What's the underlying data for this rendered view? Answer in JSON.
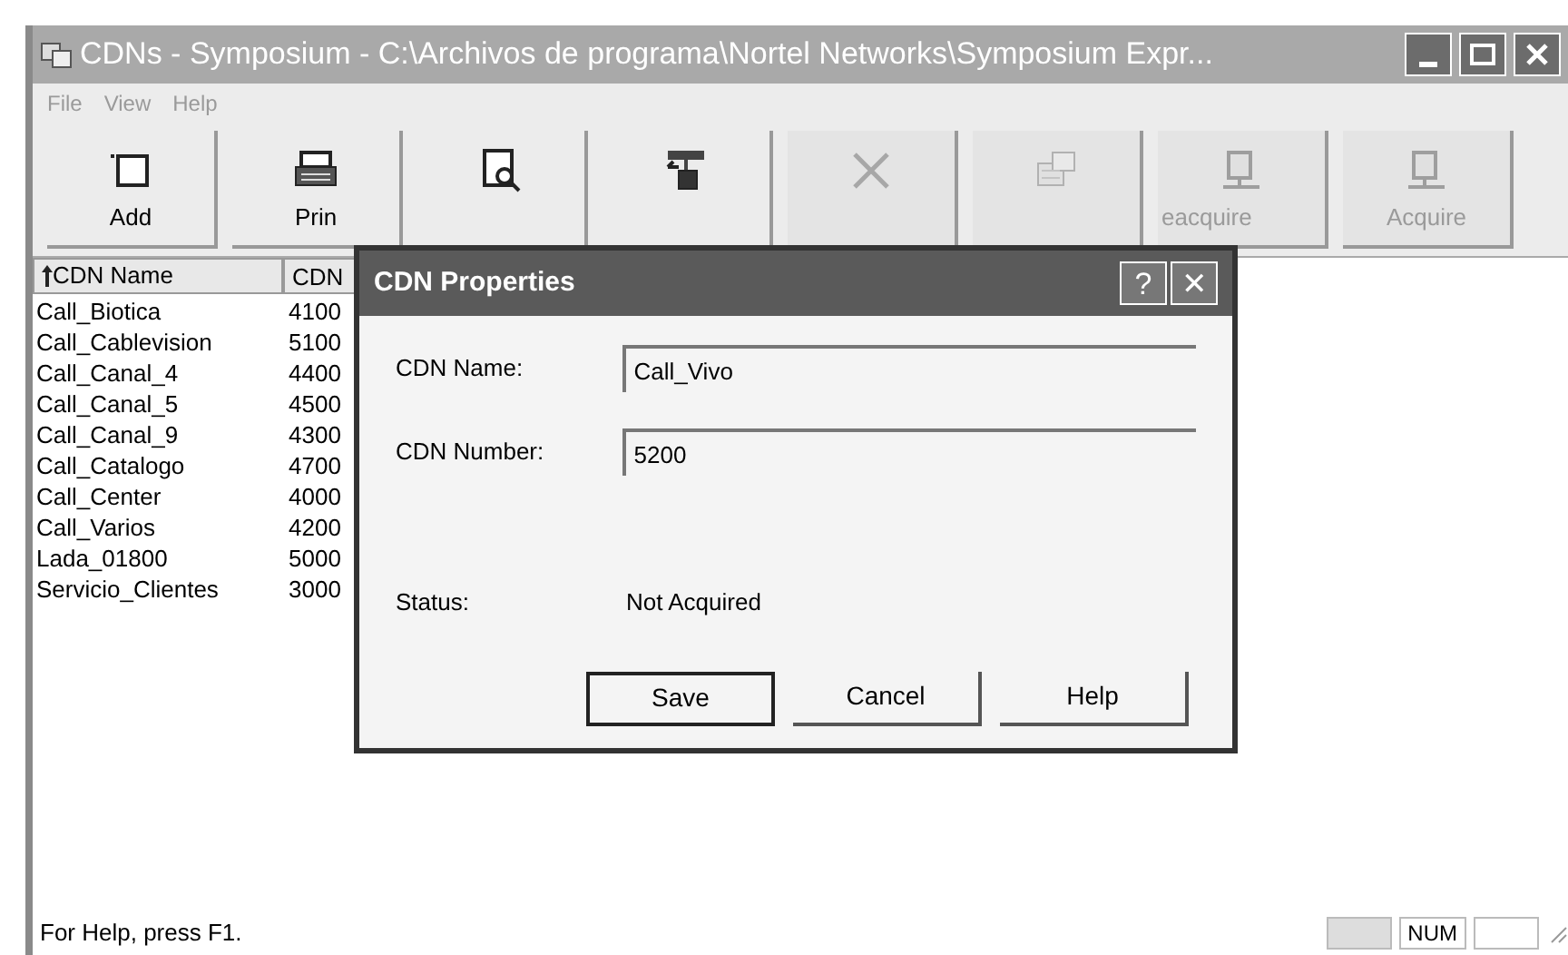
{
  "window": {
    "title": "CDNs - Symposium - C:\\Archivos de programa\\Nortel Networks\\Symposium Expr..."
  },
  "menu": [
    "File",
    "View",
    "Help"
  ],
  "toolbar": [
    {
      "kind": "add",
      "label": "Add",
      "disabled": false
    },
    {
      "kind": "print",
      "label": "Prin",
      "disabled": false
    },
    {
      "kind": "preview",
      "disabled": false
    },
    {
      "kind": "properties",
      "disabled": false
    },
    {
      "kind": "delete",
      "disabled": true
    },
    {
      "kind": "network",
      "disabled": true
    },
    {
      "kind": "reacquire",
      "label": "eacquire",
      "disabled": true
    },
    {
      "kind": "acquire",
      "label": "Acquire",
      "disabled": true
    }
  ],
  "list": {
    "columns": [
      "CDN Name",
      "CDN"
    ],
    "rows": [
      {
        "name": "Call_Biotica",
        "number": "4100"
      },
      {
        "name": "Call_Cablevision",
        "number": "5100"
      },
      {
        "name": "Call_Canal_4",
        "number": "4400"
      },
      {
        "name": "Call_Canal_5",
        "number": "4500"
      },
      {
        "name": "Call_Canal_9",
        "number": "4300"
      },
      {
        "name": "Call_Catalogo",
        "number": "4700"
      },
      {
        "name": "Call_Center",
        "number": "4000"
      },
      {
        "name": "Call_Varios",
        "number": "4200"
      },
      {
        "name": "Lada_01800",
        "number": "5000"
      },
      {
        "name": "Servicio_Clientes",
        "number": "3000"
      }
    ]
  },
  "dialog": {
    "title": "CDN Properties",
    "help_glyph": "?",
    "close_glyph": "✕",
    "fields": [
      {
        "label": "CDN Name:",
        "value": "Call_Vivo"
      },
      {
        "label": "CDN Number:",
        "value": "5200"
      }
    ],
    "status_label": "Status:",
    "status_value": "Not Acquired",
    "buttons": [
      {
        "label": "Save",
        "default": true
      },
      {
        "label": "Cancel",
        "default": false
      },
      {
        "label": "Help",
        "default": false
      }
    ]
  },
  "status_bar": {
    "text": "For Help, press F1.",
    "indicators": [
      "NUM"
    ]
  }
}
